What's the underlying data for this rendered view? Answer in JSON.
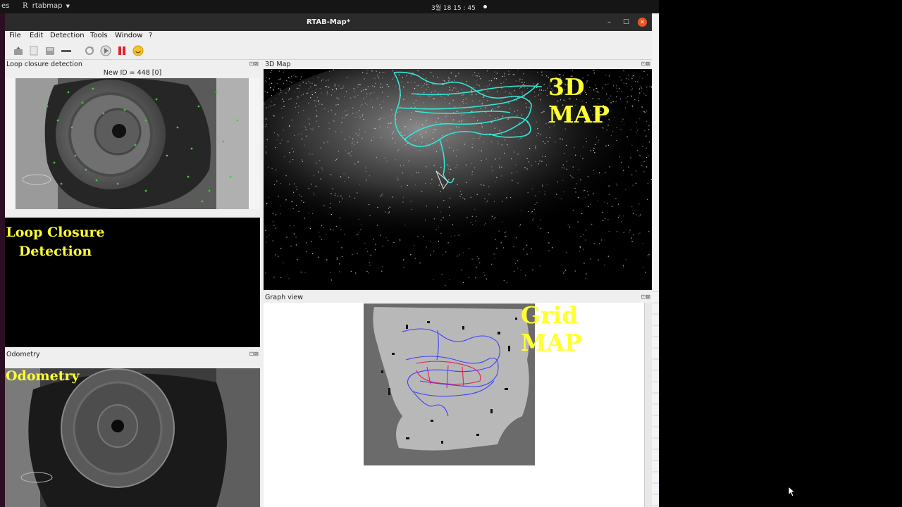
{
  "top_bar": {
    "left_stub": "es",
    "app_menu": "rtabmap",
    "app_glyph": "R",
    "clock": "3월 18  15 : 45"
  },
  "window": {
    "title": "RTAB-Map*",
    "controls": {
      "minimize": "–",
      "maximize": "□",
      "close": "✕"
    }
  },
  "menu": [
    "File",
    "Edit",
    "Detection",
    "Tools",
    "Window",
    "?"
  ],
  "toolbar_icons": [
    "open-icon",
    "new-icon",
    "save-icon",
    "edit-icon",
    "refresh-icon",
    "play-icon",
    "pause-icon",
    "smiley-icon"
  ],
  "panels": {
    "loop_closure": {
      "title": "Loop closure detection",
      "new_id": "New ID = 448 [0]",
      "overlay_line1": "Loop Closure",
      "overlay_line2": "Detection"
    },
    "map3d": {
      "title": "3D Map",
      "overlay": "3D MAP"
    },
    "graph": {
      "title": "Graph view",
      "overlay": "Grid MAP"
    },
    "odometry": {
      "title": "Odometry",
      "overlay": "Odometry"
    },
    "panel_buttons": "⊡⊠"
  },
  "colors": {
    "overlay_text": "#ffff33",
    "trajectory_3d": "#33e6d6",
    "graph_path_blue": "#4040ff",
    "graph_path_red": "#e0205a",
    "keypoints": "#3ccd3c",
    "close_button": "#e95420"
  }
}
